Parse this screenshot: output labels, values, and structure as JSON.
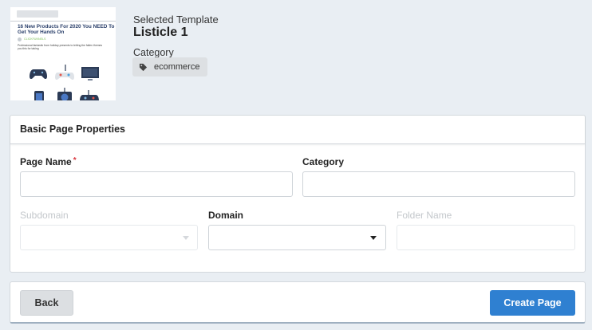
{
  "template": {
    "preview": {
      "headline": "16 New Products For 2020 You NEED To Get Your Hands On",
      "byline": "CLICKFUNNELS",
      "description": "Professional fantastic from holiday presents to letting the fallen themes you this for taking"
    },
    "selected_label": "Selected Template",
    "name": "Listicle 1",
    "category_label": "Category",
    "category_tag": "ecommerce"
  },
  "properties": {
    "title": "Basic Page Properties",
    "page_name": {
      "label": "Page Name",
      "required_mark": "*",
      "value": ""
    },
    "category": {
      "label": "Category",
      "value": ""
    },
    "subdomain": {
      "label": "Subdomain",
      "value": "",
      "disabled": true
    },
    "domain": {
      "label": "Domain",
      "value": ""
    },
    "folder_name": {
      "label": "Folder Name",
      "value": "",
      "disabled": true
    }
  },
  "footer": {
    "back_label": "Back",
    "create_label": "Create Page"
  },
  "colors": {
    "background": "#e9eef3",
    "primary": "#2f80d1",
    "required": "#d9363e"
  }
}
